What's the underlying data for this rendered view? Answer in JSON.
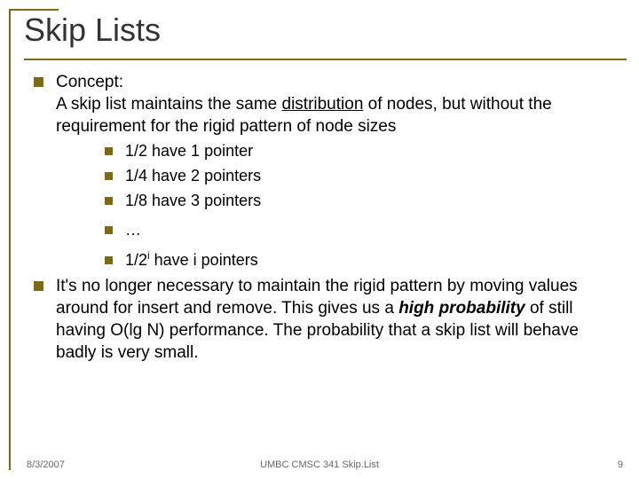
{
  "title": "Skip Lists",
  "bullets": {
    "item1": {
      "line1": "Concept:",
      "line2_pre": "A skip list maintains the same ",
      "line2_u": "distribution",
      "line2_post": " of nodes, but without the requirement for the rigid pattern of node sizes",
      "subs": {
        "s1": "1/2 have 1 pointer",
        "s2": "1/4 have 2 pointers",
        "s3": "1/8 have 3 pointers",
        "s4": "…",
        "s5_pre": "1/2",
        "s5_sup": "i",
        "s5_post": " have i pointers"
      }
    },
    "item2": {
      "pre": "It's no longer necessary to maintain the rigid pattern by moving values around for insert and remove.  This gives us a ",
      "bi": "high probability",
      "post": " of still having O(lg N) performance.  The probability that a skip list will behave badly is very small."
    }
  },
  "footer": {
    "date": "8/3/2007",
    "center": "UMBC CMSC 341 Skip.List",
    "page": "9"
  }
}
